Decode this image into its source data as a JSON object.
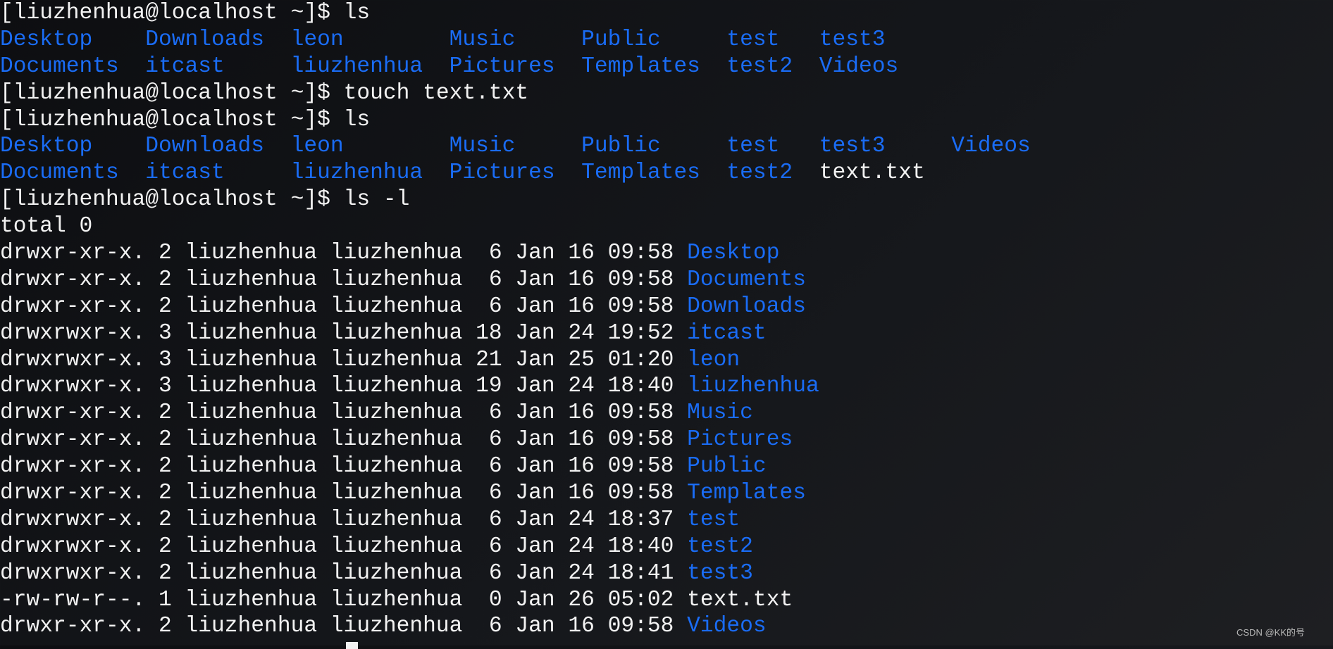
{
  "colors": {
    "text": "#f2f2f2",
    "dir": "#1a6cf5",
    "background": "#111215"
  },
  "watermark": "CSDN @KK的号",
  "lines": [
    [
      {
        "t": "[liuzhenhua@localhost ~]$ ls",
        "c": "text"
      }
    ],
    [
      {
        "t": "Desktop    Downloads  leon        Music     Public     test   test3",
        "c": "dir"
      }
    ],
    [
      {
        "t": "Documents  itcast     liuzhenhua  Pictures  Templates  test2  Videos",
        "c": "dir"
      }
    ],
    [
      {
        "t": "[liuzhenhua@localhost ~]$ touch text.txt",
        "c": "text"
      }
    ],
    [
      {
        "t": "[liuzhenhua@localhost ~]$ ls",
        "c": "text"
      }
    ],
    [
      {
        "t": "Desktop    Downloads  leon        Music     Public     test   test3     Videos",
        "c": "dir"
      }
    ],
    [
      {
        "t": "Documents  itcast     liuzhenhua  Pictures  Templates  test2  ",
        "c": "dir"
      },
      {
        "t": "text.txt",
        "c": "text"
      }
    ],
    [
      {
        "t": "[liuzhenhua@localhost ~]$ ls -l",
        "c": "text"
      }
    ],
    [
      {
        "t": "total 0",
        "c": "text"
      }
    ],
    [
      {
        "t": "drwxr-xr-x. 2 liuzhenhua liuzhenhua  6 Jan 16 09:58 ",
        "c": "text"
      },
      {
        "t": "Desktop",
        "c": "dir"
      }
    ],
    [
      {
        "t": "drwxr-xr-x. 2 liuzhenhua liuzhenhua  6 Jan 16 09:58 ",
        "c": "text"
      },
      {
        "t": "Documents",
        "c": "dir"
      }
    ],
    [
      {
        "t": "drwxr-xr-x. 2 liuzhenhua liuzhenhua  6 Jan 16 09:58 ",
        "c": "text"
      },
      {
        "t": "Downloads",
        "c": "dir"
      }
    ],
    [
      {
        "t": "drwxrwxr-x. 3 liuzhenhua liuzhenhua 18 Jan 24 19:52 ",
        "c": "text"
      },
      {
        "t": "itcast",
        "c": "dir"
      }
    ],
    [
      {
        "t": "drwxrwxr-x. 3 liuzhenhua liuzhenhua 21 Jan 25 01:20 ",
        "c": "text"
      },
      {
        "t": "leon",
        "c": "dir"
      }
    ],
    [
      {
        "t": "drwxrwxr-x. 3 liuzhenhua liuzhenhua 19 Jan 24 18:40 ",
        "c": "text"
      },
      {
        "t": "liuzhenhua",
        "c": "dir"
      }
    ],
    [
      {
        "t": "drwxr-xr-x. 2 liuzhenhua liuzhenhua  6 Jan 16 09:58 ",
        "c": "text"
      },
      {
        "t": "Music",
        "c": "dir"
      }
    ],
    [
      {
        "t": "drwxr-xr-x. 2 liuzhenhua liuzhenhua  6 Jan 16 09:58 ",
        "c": "text"
      },
      {
        "t": "Pictures",
        "c": "dir"
      }
    ],
    [
      {
        "t": "drwxr-xr-x. 2 liuzhenhua liuzhenhua  6 Jan 16 09:58 ",
        "c": "text"
      },
      {
        "t": "Public",
        "c": "dir"
      }
    ],
    [
      {
        "t": "drwxr-xr-x. 2 liuzhenhua liuzhenhua  6 Jan 16 09:58 ",
        "c": "text"
      },
      {
        "t": "Templates",
        "c": "dir"
      }
    ],
    [
      {
        "t": "drwxrwxr-x. 2 liuzhenhua liuzhenhua  6 Jan 24 18:37 ",
        "c": "text"
      },
      {
        "t": "test",
        "c": "dir"
      }
    ],
    [
      {
        "t": "drwxrwxr-x. 2 liuzhenhua liuzhenhua  6 Jan 24 18:40 ",
        "c": "text"
      },
      {
        "t": "test2",
        "c": "dir"
      }
    ],
    [
      {
        "t": "drwxrwxr-x. 2 liuzhenhua liuzhenhua  6 Jan 24 18:41 ",
        "c": "text"
      },
      {
        "t": "test3",
        "c": "dir"
      }
    ],
    [
      {
        "t": "-rw-rw-r--. 1 liuzhenhua liuzhenhua  0 Jan 26 05:02 ",
        "c": "text"
      },
      {
        "t": "text.txt",
        "c": "text"
      }
    ],
    [
      {
        "t": "drwxr-xr-x. 2 liuzhenhua liuzhenhua  6 Jan 16 09:58 ",
        "c": "text"
      },
      {
        "t": "Videos",
        "c": "dir"
      }
    ]
  ]
}
